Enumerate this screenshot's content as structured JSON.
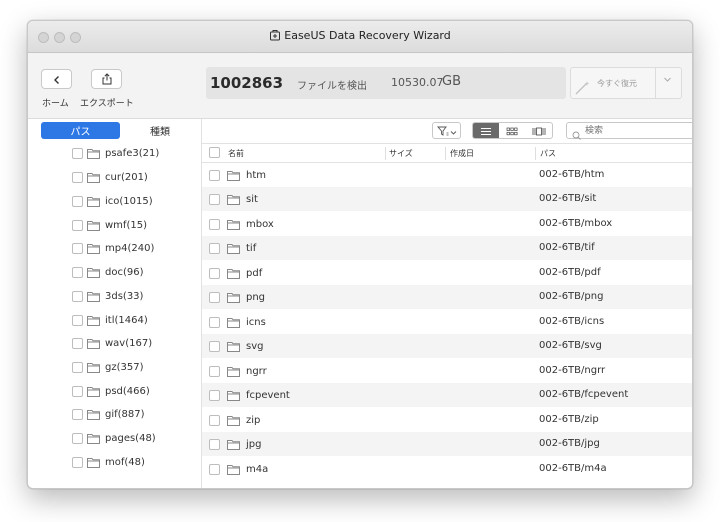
{
  "window": {
    "title": "EaseUS Data Recovery Wizard"
  },
  "toolbar": {
    "home_label": "ホーム",
    "export_label": "エクスポート",
    "files_count": "1002863",
    "files_found_label": "ファイルを検出",
    "total_size": "10530.07",
    "size_unit": "GB",
    "recover_label": "今すぐ復元"
  },
  "sidebar": {
    "tabs": [
      {
        "label": "パス",
        "active": true
      },
      {
        "label": "種類",
        "active": false
      }
    ],
    "items": [
      "psafe3(21)",
      "cur(201)",
      "ico(1015)",
      "wmf(15)",
      "mp4(240)",
      "doc(96)",
      "3ds(33)",
      "itl(1464)",
      "wav(167)",
      "gz(357)",
      "psd(466)",
      "gif(887)",
      "pages(48)",
      "mof(48)"
    ]
  },
  "search": {
    "placeholder": "検索"
  },
  "table": {
    "columns": [
      "名前",
      "サイズ",
      "作成日",
      "パス"
    ],
    "rows": [
      {
        "name": "htm",
        "path": "002-6TB/htm"
      },
      {
        "name": "sit",
        "path": "002-6TB/sit"
      },
      {
        "name": "mbox",
        "path": "002-6TB/mbox"
      },
      {
        "name": "tif",
        "path": "002-6TB/tif"
      },
      {
        "name": "pdf",
        "path": "002-6TB/pdf"
      },
      {
        "name": "png",
        "path": "002-6TB/png"
      },
      {
        "name": "icns",
        "path": "002-6TB/icns"
      },
      {
        "name": "svg",
        "path": "002-6TB/svg"
      },
      {
        "name": "ngrr",
        "path": "002-6TB/ngrr"
      },
      {
        "name": "fcpevent",
        "path": "002-6TB/fcpevent"
      },
      {
        "name": "zip",
        "path": "002-6TB/zip"
      },
      {
        "name": "jpg",
        "path": "002-6TB/jpg"
      },
      {
        "name": "m4a",
        "path": "002-6TB/m4a"
      }
    ]
  },
  "colors": {
    "accent": "#2e78e6"
  }
}
